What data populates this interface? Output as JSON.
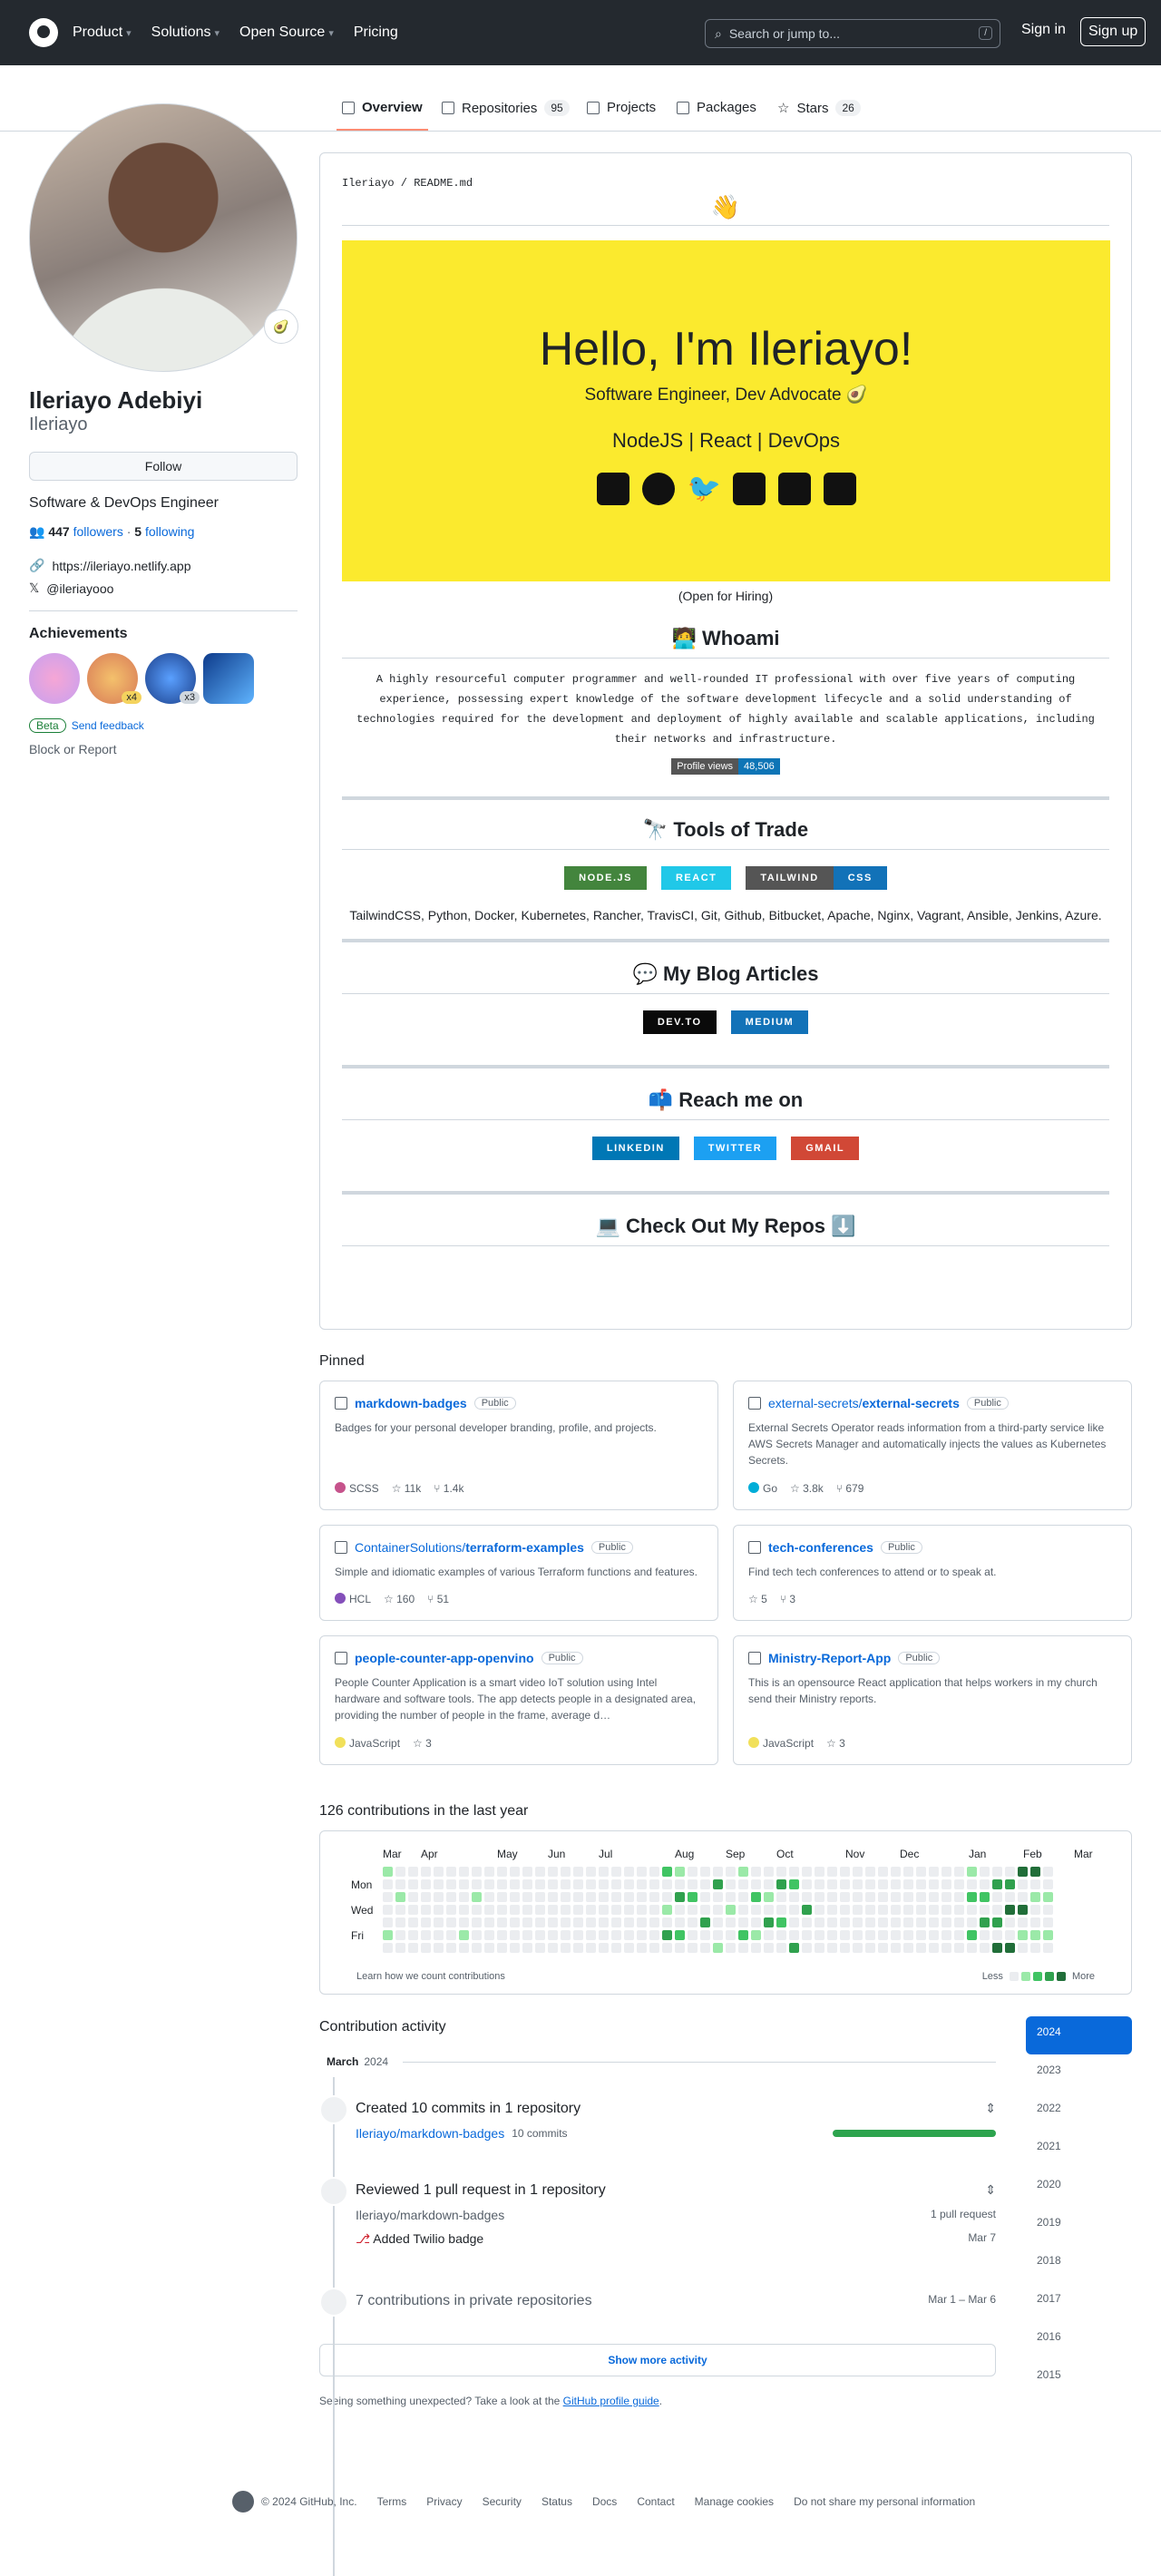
{
  "header": {
    "nav": [
      "Product",
      "Solutions",
      "Open Source",
      "Pricing"
    ],
    "search_placeholder": "Search or jump to...",
    "search_kbd": "/",
    "signin": "Sign in",
    "signup": "Sign up"
  },
  "tabs": [
    {
      "label": "Overview"
    },
    {
      "label": "Repositories",
      "count": "95"
    },
    {
      "label": "Projects"
    },
    {
      "label": "Packages"
    },
    {
      "label": "Stars",
      "count": "26"
    }
  ],
  "profile": {
    "name": "Ileriayo Adebiyi",
    "login": "Ileriayo",
    "follow": "Follow",
    "bio": "Software & DevOps Engineer",
    "followers": "447",
    "followers_label": "followers",
    "following": "5",
    "following_label": "following",
    "website": "https://ileriayo.netlify.app",
    "twitter": "@ileriayooo",
    "achievements_title": "Achievements",
    "badge_counts": [
      "x4",
      "x3"
    ],
    "beta": "Beta",
    "feedback": "Send feedback",
    "block": "Block or Report"
  },
  "readme": {
    "crumb_user": "Ileriayo",
    "crumb_file": "README.md",
    "wave": "👋",
    "hello": "Hello, I'm Ileriayo!",
    "subtitle": "Software Engineer, Dev Advocate 🥑",
    "stack": "NodeJS | React | DevOps",
    "hire": "(Open for Hiring)",
    "whoami": "🧑‍💻 Whoami",
    "bio": "A highly resourceful computer programmer and well-rounded IT professional with over five years of computing experience, possessing expert knowledge of the software development lifecycle and a solid understanding of technologies required for the development and deployment of highly available and scalable applications, including their networks and infrastructure.",
    "pv_label": "Profile views",
    "pv_value": "48,506",
    "tools": "🔭 Tools of Trade",
    "tool_badges": [
      "NODE.JS",
      "REACT",
      "TAILWIND",
      "CSS"
    ],
    "tools_text": "TailwindCSS, Python, Docker, Kubernetes, Rancher, TravisCI, Git, Github, Bitbucket, Apache, Nginx, Vagrant, Ansible, Jenkins, Azure.",
    "blog": "💬 My Blog Articles",
    "blog_badges": [
      "DEV.TO",
      "MEDIUM"
    ],
    "reach": "📫 Reach me on",
    "reach_badges": [
      "LINKEDIN",
      "TWITTER",
      "GMAIL"
    ],
    "repos": "💻 Check Out My Repos ⬇️"
  },
  "pinned_title": "Pinned",
  "pinned": [
    {
      "owner": "",
      "repo": "markdown-badges",
      "vis": "Public",
      "desc": "Badges for your personal developer branding, profile, and projects.",
      "lang": "SCSS",
      "color": "#c6538c",
      "stars": "11k",
      "forks": "1.4k"
    },
    {
      "owner": "external-secrets/",
      "repo": "external-secrets",
      "vis": "Public",
      "desc": "External Secrets Operator reads information from a third-party service like AWS Secrets Manager and automatically injects the values as Kubernetes Secrets.",
      "lang": "Go",
      "color": "#00ADD8",
      "stars": "3.8k",
      "forks": "679"
    },
    {
      "owner": "ContainerSolutions/",
      "repo": "terraform-examples",
      "vis": "Public",
      "desc": "Simple and idiomatic examples of various Terraform functions and features.",
      "lang": "HCL",
      "color": "#844FBA",
      "stars": "160",
      "forks": "51"
    },
    {
      "owner": "",
      "repo": "tech-conferences",
      "vis": "Public",
      "desc": "Find tech tech conferences to attend or to speak at.",
      "lang": "",
      "color": "",
      "stars": "5",
      "forks": "3"
    },
    {
      "owner": "",
      "repo": "people-counter-app-openvino",
      "vis": "Public",
      "desc": "People Counter Application is a smart video IoT solution using Intel hardware and software tools. The app detects people in a designated area, providing the number of people in the frame, average d…",
      "lang": "JavaScript",
      "color": "#f1e05a",
      "stars": "3",
      "forks": ""
    },
    {
      "owner": "",
      "repo": "Ministry-Report-App",
      "vis": "Public",
      "desc": "This is an opensource React application that helps workers in my church send their Ministry reports.",
      "lang": "JavaScript",
      "color": "#f1e05a",
      "stars": "3",
      "forks": ""
    }
  ],
  "contrib": {
    "title": "126 contributions in the last year",
    "months": [
      "Mar",
      "Apr",
      "May",
      "Jun",
      "Jul",
      "Aug",
      "Sep",
      "Oct",
      "Nov",
      "Dec",
      "Jan",
      "Feb",
      "Mar"
    ],
    "days": [
      "Mon",
      "Wed",
      "Fri"
    ],
    "learn": "Learn how we count contributions",
    "less": "Less",
    "more": "More",
    "colors": [
      "#ebedf0",
      "#9be9a8",
      "#40c463",
      "#30a14e",
      "#216e39"
    ]
  },
  "activity": {
    "title": "Contribution activity",
    "month": "March",
    "year": "2024",
    "years": [
      "2024",
      "2023",
      "2022",
      "2021",
      "2020",
      "2019",
      "2018",
      "2017",
      "2016",
      "2015"
    ],
    "commits": "Created 10 commits in 1 repository",
    "commit_repo": "Ileriayo/markdown-badges",
    "commit_count": "10 commits",
    "review": "Reviewed 1 pull request in 1 repository",
    "review_repo": "Ileriayo/markdown-badges",
    "review_count": "1 pull request",
    "pr": "Added Twilio badge",
    "pr_date": "Mar 7",
    "private": "7 contributions in private repositories",
    "private_date": "Mar 1 – Mar 6",
    "more": "Show more activity",
    "unexpected": "Seeing something unexpected? Take a look at the",
    "guide": "GitHub profile guide"
  },
  "footer": [
    "© 2024 GitHub, Inc.",
    "Terms",
    "Privacy",
    "Security",
    "Status",
    "Docs",
    "Contact",
    "Manage cookies",
    "Do not share my personal information"
  ]
}
